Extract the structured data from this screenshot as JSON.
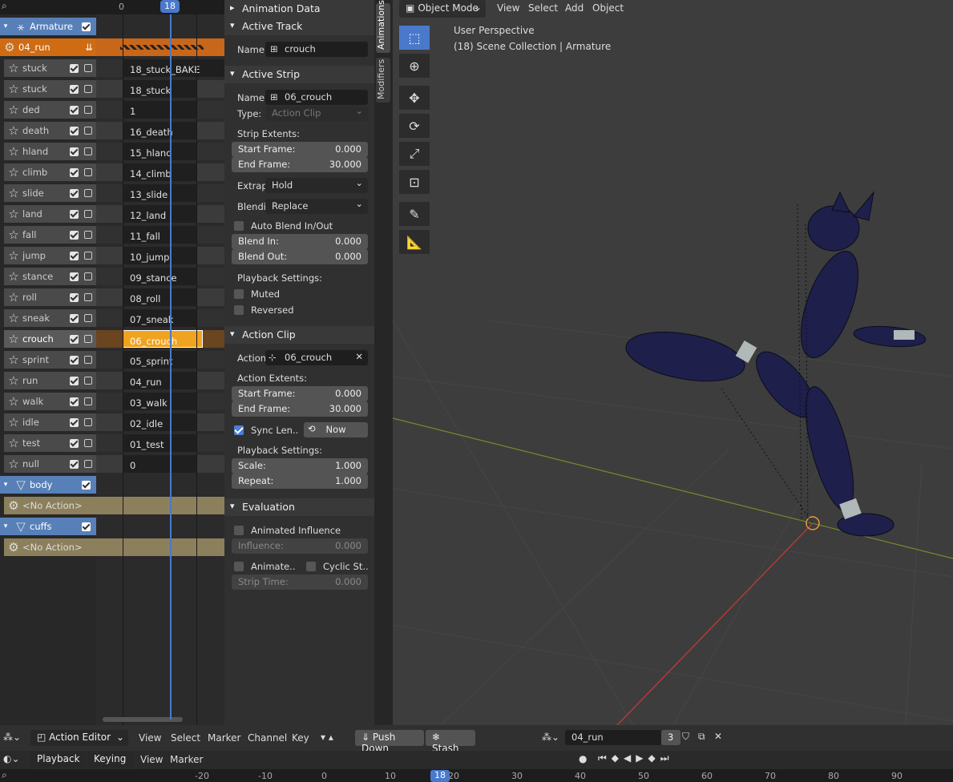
{
  "nla": {
    "frame_ruler": {
      "ticks": [
        "0"
      ],
      "current": "18"
    },
    "channels": [
      {
        "name": "Armature",
        "kind": "group"
      },
      {
        "name": "04_run",
        "kind": "action"
      },
      {
        "name": "stuck",
        "kind": "track"
      },
      {
        "name": "stuck",
        "kind": "track"
      },
      {
        "name": "ded",
        "kind": "track"
      },
      {
        "name": "death",
        "kind": "track"
      },
      {
        "name": "hland",
        "kind": "track"
      },
      {
        "name": "climb",
        "kind": "track"
      },
      {
        "name": "slide",
        "kind": "track"
      },
      {
        "name": "land",
        "kind": "track"
      },
      {
        "name": "fall",
        "kind": "track"
      },
      {
        "name": "jump",
        "kind": "track"
      },
      {
        "name": "stance",
        "kind": "track"
      },
      {
        "name": "roll",
        "kind": "track"
      },
      {
        "name": "sneak",
        "kind": "track"
      },
      {
        "name": "crouch",
        "kind": "track",
        "selected": true
      },
      {
        "name": "sprint",
        "kind": "track"
      },
      {
        "name": "run",
        "kind": "track"
      },
      {
        "name": "walk",
        "kind": "track"
      },
      {
        "name": "idle",
        "kind": "track"
      },
      {
        "name": "test",
        "kind": "track"
      },
      {
        "name": "null",
        "kind": "track"
      },
      {
        "name": "body",
        "kind": "group"
      },
      {
        "name": "<No Action>",
        "kind": "noact"
      },
      {
        "name": "cuffs",
        "kind": "group"
      },
      {
        "name": "<No Action>",
        "kind": "noact"
      }
    ],
    "strips": [
      "",
      "",
      "18_stuck_BAKE",
      "18_stuck",
      "1",
      "16_death",
      "15_hland",
      "14_climb",
      "13_slide",
      "12_land",
      "11_fall",
      "10_jump",
      "09_stance",
      "08_roll",
      "07_sneak",
      "06_crouch",
      "05_sprint",
      "04_run",
      "03_walk",
      "02_idle",
      "01_test",
      "0"
    ]
  },
  "props": {
    "animation_data": "Animation Data",
    "active_track": "Active Track",
    "name_label": "Name:",
    "track_name": "crouch",
    "active_strip": "Active Strip",
    "strip_name": "06_crouch",
    "type_label": "Type:",
    "type_value": "Action Clip",
    "strip_extents": "Strip Extents:",
    "start_frame_label": "Start Frame:",
    "start_frame": "0.000",
    "end_frame_label": "End Frame:",
    "end_frame": "30.000",
    "extrap_label": "Extrap",
    "extrap_value": "Hold",
    "blend_label": "Blendi",
    "blend_value": "Replace",
    "auto_blend": "Auto Blend In/Out",
    "blend_in_label": "Blend In:",
    "blend_in": "0.000",
    "blend_out_label": "Blend Out:",
    "blend_out": "0.000",
    "playback_settings": "Playback Settings:",
    "muted": "Muted",
    "reversed": "Reversed",
    "action_clip": "Action Clip",
    "action_label": "Action:",
    "action_value": "06_crouch",
    "action_extents": "Action Extents:",
    "a_start_frame": "0.000",
    "a_end_frame": "30.000",
    "sync_length": "Sync Len..",
    "now": "Now",
    "scale_label": "Scale:",
    "scale": "1.000",
    "repeat_label": "Repeat:",
    "repeat": "1.000",
    "evaluation": "Evaluation",
    "animated_influence": "Animated Influence",
    "influence_label": "Influence:",
    "influence": "0.000",
    "animate_time": "Animate..",
    "cyclic_time": "Cyclic St..",
    "strip_time_label": "Strip Time:",
    "strip_time": "0.000"
  },
  "tabs": {
    "animations": "Animations",
    "modifiers": "Modifiers"
  },
  "viewport": {
    "mode": "Object Mode",
    "menus": [
      "View",
      "Select",
      "Add",
      "Object"
    ],
    "perspective": "User Perspective",
    "collection": "(18) Scene Collection | Armature"
  },
  "bottom": {
    "editor": "Action Editor",
    "menus": [
      "View",
      "Select",
      "Marker",
      "Channel",
      "Key"
    ],
    "push_down": "Push Down",
    "stash": "Stash",
    "action_name": "04_run",
    "users": "3",
    "playback": "Playback",
    "keying": "Keying",
    "view": "View",
    "marker": "Marker",
    "timeline_ticks": [
      "-20",
      "-10",
      "0",
      "10",
      "20",
      "30",
      "40",
      "50",
      "60",
      "70",
      "80",
      "90"
    ],
    "current_frame": "18"
  },
  "colors": {
    "accent": "#4a79cc",
    "selected_strip": "#f0a320",
    "action_row": "#cf6c13"
  }
}
